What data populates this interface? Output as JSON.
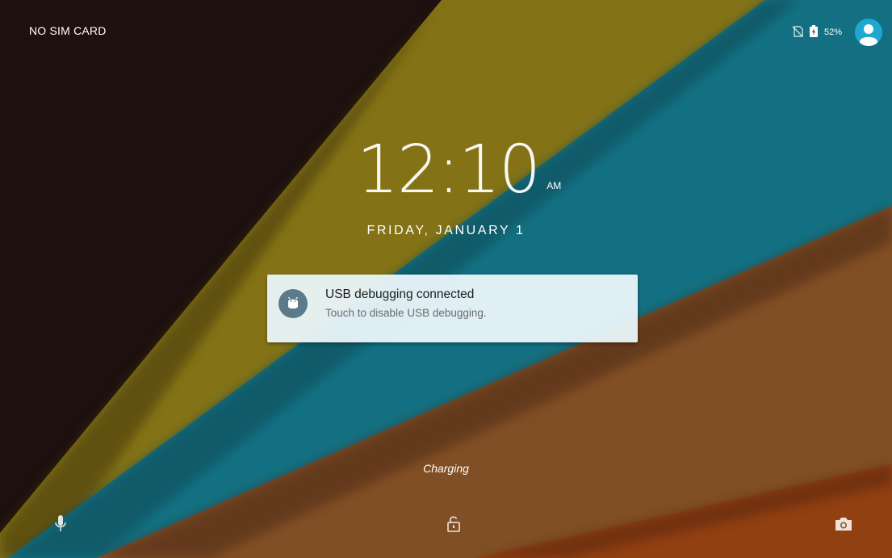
{
  "status_bar": {
    "carrier": "NO SIM CARD",
    "battery_percent": "52%",
    "icons": [
      "no-sim-icon",
      "battery-charging-icon",
      "user-avatar-icon"
    ]
  },
  "clock": {
    "time": "12:10",
    "ampm": "AM",
    "date": "FRIDAY, JANUARY 1"
  },
  "notification": {
    "icon": "android-debug-icon",
    "title": "USB debugging connected",
    "text": "Touch to disable USB debugging."
  },
  "lockscreen": {
    "status": "Charging",
    "shortcuts": [
      "microphone-icon",
      "unlock-icon",
      "camera-icon"
    ]
  },
  "colors": {
    "dark_band": "#1f1210",
    "olive_band": "#8b7a1a",
    "teal_band": "#14778a",
    "brown_band": "#8a5328",
    "orange_band": "#9a4314",
    "avatar_accent": "#1ea7d0",
    "notification_bg": "#eaf5fa"
  }
}
